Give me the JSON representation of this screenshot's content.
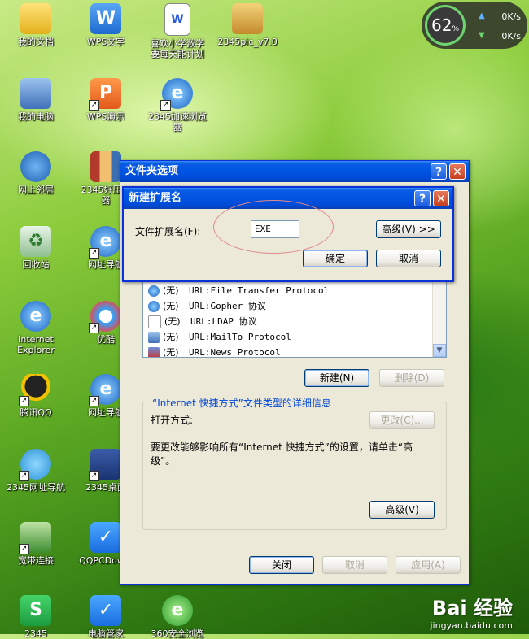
{
  "desktop": {
    "icons": [
      {
        "label": "我的文档",
        "icon": "my-documents-icon"
      },
      {
        "label": "WPS文字",
        "icon": "wps-writer-icon"
      },
      {
        "label": "喜欢小学数学\n要每天能计划",
        "icon": "word-document-icon"
      },
      {
        "label": "2345pic_v7.0",
        "icon": "installer-package-icon"
      },
      {
        "label": "我的电脑",
        "icon": "my-computer-icon"
      },
      {
        "label": "WPS演示",
        "icon": "wps-presentation-icon"
      },
      {
        "label": "2345加速浏览\n器",
        "icon": "browser-icon"
      },
      {
        "label": "网上邻居",
        "icon": "network-places-icon"
      },
      {
        "label": "2345好压缩\n器",
        "icon": "archive-icon"
      },
      {
        "label": "回收站",
        "icon": "recycle-bin-icon"
      },
      {
        "label": "网址导航",
        "icon": "ie-shortcut-icon"
      },
      {
        "label": "Internet\nExplorer",
        "icon": "internet-explorer-icon"
      },
      {
        "label": "优酷",
        "icon": "youku-icon"
      },
      {
        "label": "腾讯QQ",
        "icon": "qq-penguin-icon"
      },
      {
        "label": "网址导航",
        "icon": "ie-shortcut-icon"
      },
      {
        "label": "2345网址导航",
        "icon": "qq-bird-icon"
      },
      {
        "label": "2345桌面",
        "icon": "desktop-app-icon"
      },
      {
        "label": "宽带连接",
        "icon": "broadband-connection-icon"
      },
      {
        "label": "QQPCDownl",
        "icon": "qq-pc-manager-icon"
      },
      {
        "label": "2345",
        "icon": "green-app-icon"
      },
      {
        "label": "电脑管家",
        "icon": "pc-manager-icon"
      },
      {
        "label": "360安全浏览",
        "icon": "360-browser-icon"
      }
    ]
  },
  "widget": {
    "percent": "62",
    "percent_unit": "%",
    "upload": "0K/s",
    "download": "0K/s"
  },
  "folder_options": {
    "title": "文件夹选项",
    "list_rows": [
      {
        "ext": "(无)",
        "type": "URL:File Transfer Protocol",
        "icon": "ie-url-icon"
      },
      {
        "ext": "(无)",
        "type": "URL:Gopher 协议",
        "icon": "ie-url-icon"
      },
      {
        "ext": "(无)",
        "type": "URL:LDAP 协议",
        "icon": "ldap-url-icon"
      },
      {
        "ext": "(无)",
        "type": "URL:MailTo Protocol",
        "icon": "mailto-url-icon"
      },
      {
        "ext": "(无)",
        "type": "URL:News Protocol",
        "icon": "news-url-icon"
      }
    ],
    "new_button": "新建(N)",
    "delete_button": "删除(D)",
    "details_caption": "“Internet 快捷方式”文件类型的详细信息",
    "opens_with_label": "打开方式:",
    "change_button": "更改(C)...",
    "description": "要更改能够影响所有“Internet 快捷方式”的设置，请单击“高级”。",
    "advanced_button": "高级(V)",
    "close_button": "关闭",
    "cancel_button": "取消",
    "apply_button": "应用(A)"
  },
  "new_extension": {
    "title": "新建扩展名",
    "field_label": "文件扩展名(F):",
    "field_value": "EXE",
    "advanced_button": "高级(V) >>",
    "ok_button": "确定",
    "cancel_button": "取消"
  },
  "watermark": {
    "brand": "Bai 经验",
    "url": "jingyan.baidu.com"
  }
}
